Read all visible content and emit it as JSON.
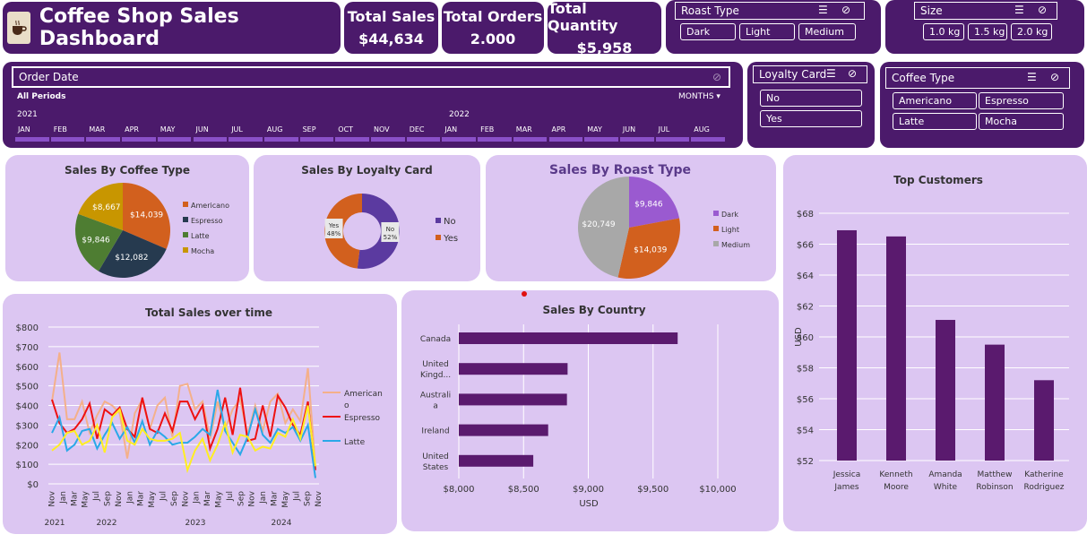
{
  "header": {
    "title": "Coffee Shop Sales Dashboard",
    "logo_icon": "coffee-cup-icon"
  },
  "kpis": [
    {
      "label": "Total Sales",
      "value": "$44,634"
    },
    {
      "label": "Total Orders",
      "value": "2.000"
    },
    {
      "label": "Total Quantity",
      "value": "$5,958"
    }
  ],
  "roast_slicer": {
    "title": "Roast Type",
    "options": [
      "Dark",
      "Light",
      "Medium"
    ]
  },
  "size_slicer": {
    "title": "Size",
    "options": [
      "1.0 kg",
      "1.5 kg",
      "2.0 kg"
    ]
  },
  "loyalty_slicer": {
    "title": "Loyalty Card",
    "options": [
      "No",
      "Yes"
    ]
  },
  "coffee_slicer": {
    "title": "Coffee Type",
    "options": [
      "Americano",
      "Espresso",
      "Latte",
      "Mocha"
    ]
  },
  "timeline": {
    "title": "Order Date",
    "period": "All Periods",
    "unit": "MONTHS",
    "years": [
      "2021",
      "2022"
    ],
    "months": [
      "JAN",
      "FEB",
      "MAR",
      "APR",
      "MAY",
      "JUN",
      "JUL",
      "AUG",
      "SEP",
      "OCT",
      "NOV",
      "DEC",
      "JAN",
      "FEB",
      "MAR",
      "APR",
      "MAY",
      "JUN",
      "JUL",
      "AUG"
    ]
  },
  "colors": {
    "dark": "#4b1a6b",
    "panel": "#dcc6f2",
    "bar": "#5a1a6e",
    "americano": "#f4b08a",
    "espresso": "#ee1111",
    "latte": "#2aa8e8",
    "mocha": "#ffee22"
  },
  "chart_data": [
    {
      "type": "pie",
      "title": "Sales By Coffee Type",
      "labels": [
        "Americano",
        "Espresso",
        "Latte",
        "Mocha"
      ],
      "values": [
        14039,
        12082,
        9846,
        8667
      ],
      "value_labels": [
        "$14,039",
        "$12,082",
        "$9,846",
        "$8,667"
      ],
      "colors": [
        "#d2601e",
        "#263a4f",
        "#4e7d32",
        "#c89600"
      ],
      "legend_position": "right"
    },
    {
      "type": "pie",
      "title": "Sales By Loyalty Card",
      "donut": true,
      "labels": [
        "No",
        "Yes"
      ],
      "values": [
        52,
        48
      ],
      "value_labels": [
        "No\n52%",
        "Yes\n48%"
      ],
      "colors": [
        "#5b3aa0",
        "#d2601e"
      ],
      "legend_position": "right"
    },
    {
      "type": "pie",
      "title": "Sales By Roast Type",
      "labels": [
        "Dark",
        "Light",
        "Medium"
      ],
      "values": [
        9846,
        14039,
        20749
      ],
      "value_labels": [
        "$9,846",
        "$14,039",
        "$20,749"
      ],
      "colors": [
        "#9a5ad0",
        "#d2601e",
        "#a8a8a8"
      ],
      "legend_position": "right"
    },
    {
      "type": "bar",
      "title": "Top Customers",
      "categories": [
        "Jessica James",
        "Kenneth Moore",
        "Amanda White",
        "Matthew Robinson",
        "Katherine Rodriguez"
      ],
      "values": [
        66.9,
        66.5,
        61.1,
        59.5,
        57.2
      ],
      "ylabel": "USD",
      "ylim": [
        52,
        68
      ],
      "yticks": [
        "$52",
        "$54",
        "$56",
        "$58",
        "$60",
        "$62",
        "$64",
        "$66",
        "$68"
      ],
      "grid": true
    },
    {
      "type": "bar",
      "orientation": "horizontal",
      "title": "Sales By Country",
      "categories": [
        "Canada",
        "United Kingd...",
        "Australia",
        "Ireland",
        "United States"
      ],
      "values": [
        9690,
        8840,
        8835,
        8690,
        8575
      ],
      "xlabel": "USD",
      "xlim": [
        8000,
        10000
      ],
      "xticks": [
        "$8,000",
        "$8,500",
        "$9,000",
        "$9,500",
        "$10,000"
      ],
      "grid": true
    },
    {
      "type": "line",
      "title": "Total Sales over time",
      "ylim": [
        0,
        800
      ],
      "yticks": [
        "$0",
        "$100",
        "$200",
        "$300",
        "$400",
        "$500",
        "$600",
        "$700",
        "$800"
      ],
      "xticks": [
        "Nov",
        "Jan",
        "Mar",
        "May",
        "Jul",
        "Sep",
        "Nov",
        "Jan",
        "Mar",
        "May",
        "Jul",
        "Sep",
        "Nov",
        "Jan",
        "Mar",
        "May",
        "Jul",
        "Sep",
        "Nov",
        "Jan",
        "Mar",
        "May",
        "Jul",
        "Sep",
        "Nov"
      ],
      "years": [
        "2021",
        "2022",
        "2023",
        "2024"
      ],
      "legend_position": "right",
      "series": [
        {
          "name": "Americano",
          "color": "#f4b08a",
          "values": [
            420,
            670,
            330,
            330,
            420,
            260,
            350,
            420,
            400,
            360,
            130,
            360,
            430,
            280,
            400,
            440,
            240,
            500,
            510,
            380,
            420,
            230,
            420,
            280,
            380,
            430,
            250,
            400,
            270,
            420,
            460,
            310,
            380,
            320,
            590,
            80
          ]
        },
        {
          "name": "Espresso",
          "color": "#ee1111",
          "values": [
            430,
            310,
            260,
            280,
            330,
            410,
            230,
            380,
            350,
            390,
            280,
            240,
            440,
            280,
            260,
            360,
            270,
            420,
            420,
            330,
            400,
            180,
            280,
            440,
            250,
            490,
            220,
            230,
            400,
            240,
            450,
            390,
            300,
            250,
            420,
            70
          ]
        },
        {
          "name": "Latte",
          "color": "#2aa8e8",
          "values": [
            260,
            340,
            170,
            200,
            270,
            280,
            180,
            250,
            310,
            230,
            290,
            210,
            320,
            200,
            270,
            240,
            200,
            210,
            210,
            240,
            280,
            250,
            480,
            270,
            210,
            150,
            240,
            380,
            250,
            210,
            280,
            260,
            290,
            220,
            300,
            30
          ]
        },
        {
          "name": "Mocha",
          "color": "#ffee22",
          "values": [
            170,
            200,
            260,
            270,
            200,
            220,
            300,
            160,
            340,
            380,
            220,
            200,
            280,
            230,
            220,
            220,
            230,
            260,
            70,
            170,
            230,
            120,
            200,
            310,
            160,
            250,
            240,
            170,
            190,
            180,
            260,
            240,
            330,
            230,
            400,
            90
          ]
        }
      ]
    }
  ]
}
